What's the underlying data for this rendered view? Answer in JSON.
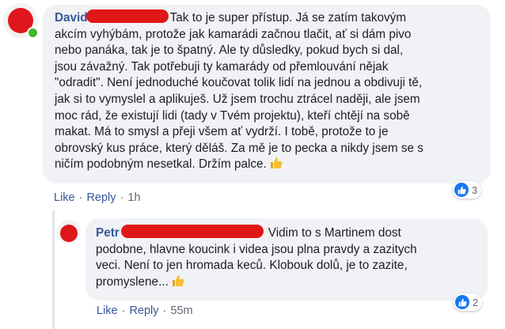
{
  "colors": {
    "bubble_bg": "#f0f2f5",
    "author_link": "#385898",
    "action_link": "#365899",
    "meta_text": "#606770",
    "like_blue": "#1877f2",
    "redaction_red": "#e01717"
  },
  "comments": [
    {
      "author": "David",
      "text_lines": [
        "Tak to je super přístup. Já se zatím takovým",
        "akcím vyhýbám, protože jak kamarádi začnou tlačit, ať si dám pivo",
        "nebo panáka, tak je to špatný. Ale ty důsledky, pokud bych si dal,",
        "jsou závažný. Tak potřebuji ty kamarády od přemlouvání nějak",
        "\"odradit\". Není jednoduché koučovat tolik lidí na jednou a obdivuji tě,",
        "jak si to vymyslel a aplikuješ. Už jsem trochu ztrácel naději, ale jsem",
        "moc rád, že existují lidi (tady v Tvém projektu), kteří chtějí na sobě",
        "makat. Má to smysl a přeji všem ať vydrží. I tobě, protože to je",
        "obrovský kus práce, který děláš. Za mě je to pecka a nikdy jsem se s",
        "ničím podobným nesetkal. Držím palce."
      ],
      "emoji_icon": "thumbs-up-icon",
      "actions": {
        "like": "Like",
        "reply": "Reply",
        "time": "1h"
      },
      "reactions": {
        "type": "like-icon",
        "count": "3"
      },
      "online": true
    },
    {
      "author": "Petr",
      "text_lines": [
        "Vidim to s Martinem dost",
        "podobne, hlavne koucink i videa jsou plna pravdy a zazitych",
        "veci. Není to jen hromada keců. Klobouk dolů, je to zazite,",
        "promyslene..."
      ],
      "emoji_icon": "thumbs-up-icon",
      "actions": {
        "like": "Like",
        "reply": "Reply",
        "time": "55m"
      },
      "reactions": {
        "type": "like-icon",
        "count": "2"
      }
    }
  ]
}
